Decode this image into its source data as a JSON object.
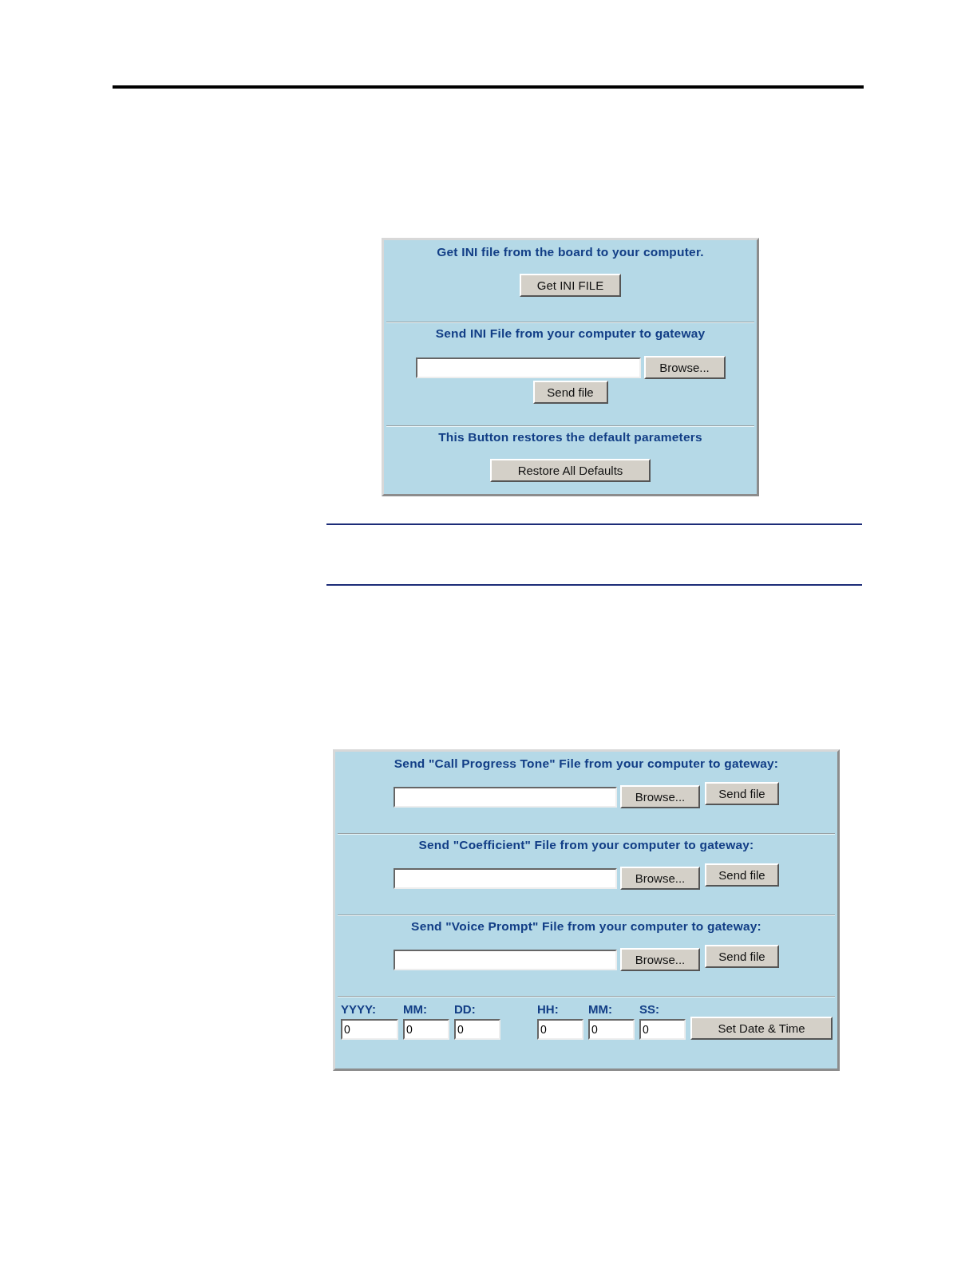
{
  "panel_1": {
    "sections": [
      {
        "kind": "button",
        "heading": "Get INI file from the board to your computer.",
        "button": "Get INI FILE"
      },
      {
        "kind": "upload_stacked",
        "heading": "Send INI File from your computer to gateway",
        "browse": "Browse...",
        "send": "Send file"
      },
      {
        "kind": "button",
        "heading": "This Button restores the default parameters",
        "button": "Restore All Defaults"
      }
    ]
  },
  "panel_2": {
    "sections": [
      {
        "kind": "upload_inline",
        "heading": "Send \"Call Progress Tone\" File from your computer to gateway:",
        "browse": "Browse...",
        "send": "Send file"
      },
      {
        "kind": "upload_inline",
        "heading": "Send \"Coefficient\" File from your computer to gateway:",
        "browse": "Browse...",
        "send": "Send file"
      },
      {
        "kind": "upload_inline",
        "heading": "Send \"Voice Prompt\" File from your computer to gateway:",
        "browse": "Browse...",
        "send": "Send file"
      },
      {
        "kind": "date_time",
        "fields": [
          {
            "label": "YYYY:",
            "value": "0"
          },
          {
            "label": "MM:",
            "value": "0"
          },
          {
            "label": "DD:",
            "value": "0"
          },
          {
            "label": "HH:",
            "value": "0"
          },
          {
            "label": "MM:",
            "value": "0"
          },
          {
            "label": "SS:",
            "value": "0"
          }
        ],
        "button": "Set Date & Time"
      }
    ]
  }
}
